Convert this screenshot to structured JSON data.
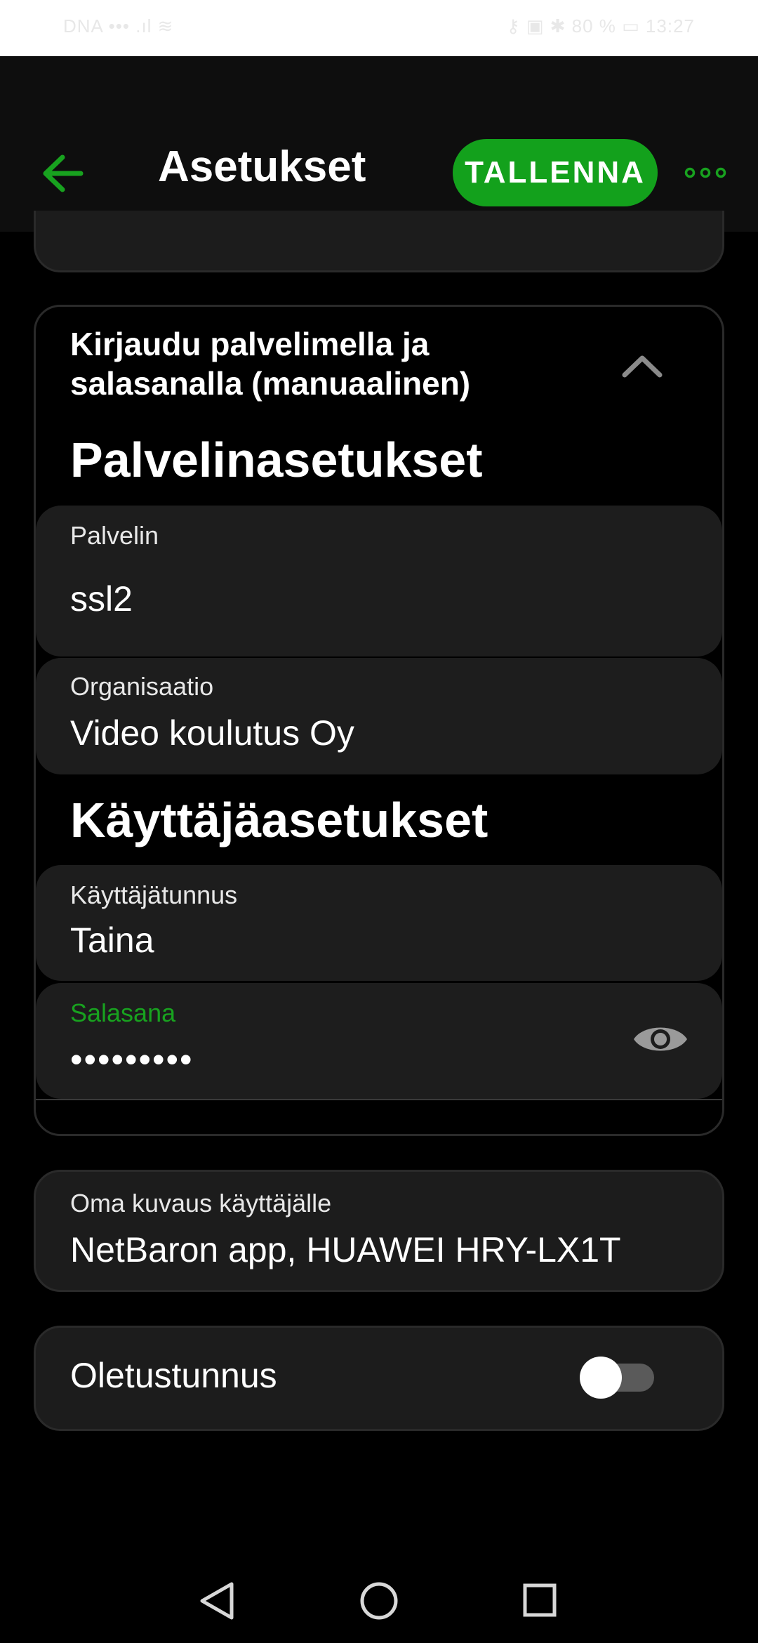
{
  "status": {
    "left": "DNA ••• .ıl ≋",
    "right": "⚷ ▣ ✱ 80 % ▭ 13:27"
  },
  "appbar": {
    "title": "Asetukset",
    "save_label": "TALLENNA"
  },
  "section": {
    "header": "Kirjaudu palvelimella ja salasanalla (manuaalinen)",
    "server_settings": "Palvelinasetukset",
    "user_settings": "Käyttäjäasetukset"
  },
  "fields": {
    "server": {
      "label": "Palvelin",
      "value": "ssl2"
    },
    "organization": {
      "label": "Organisaatio",
      "value": "Video koulutus Oy"
    },
    "username": {
      "label": "Käyttäjätunnus",
      "value": "Taina"
    },
    "password": {
      "label": "Salasana",
      "value": "•••••••••"
    },
    "description": {
      "label": "Oma kuvaus käyttäjälle",
      "value": "NetBaron app, HUAWEI HRY-LX1T"
    }
  },
  "default_account": {
    "label": "Oletustunnus",
    "enabled": false
  },
  "colors": {
    "accent": "#13a11c",
    "field_bg": "#1d1d1d",
    "appbar_bg": "#0e0e0e"
  },
  "icons": [
    "back-arrow-icon",
    "more-options-icon",
    "chevron-up-icon",
    "eye-icon",
    "nav-back-icon",
    "nav-home-icon",
    "nav-recents-icon"
  ]
}
